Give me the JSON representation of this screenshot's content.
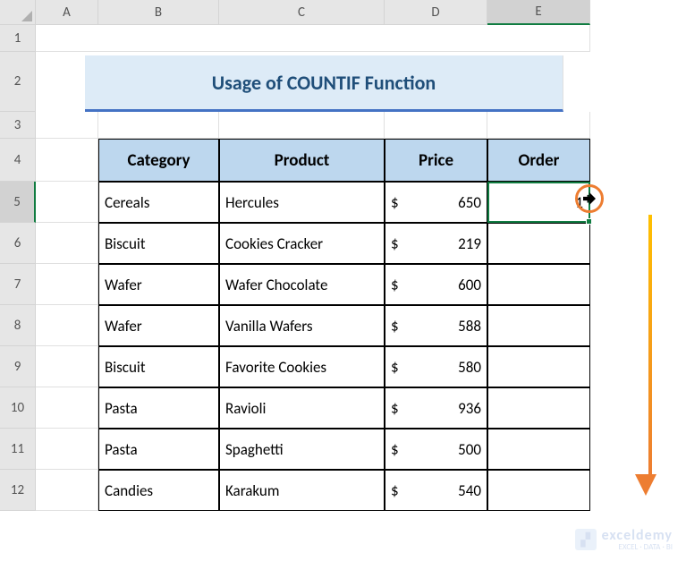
{
  "columns": [
    "A",
    "B",
    "C",
    "D",
    "E"
  ],
  "rows": [
    "1",
    "2",
    "3",
    "4",
    "5",
    "6",
    "7",
    "8",
    "9",
    "10",
    "11",
    "12"
  ],
  "title": "Usage of COUNTIF Function",
  "headers": {
    "category": "Category",
    "product": "Product",
    "price": "Price",
    "order": "Order"
  },
  "currency": "$",
  "data": [
    {
      "category": "Cereals",
      "product": "Hercules",
      "price": "650",
      "order": "1"
    },
    {
      "category": "Biscuit",
      "product": "Cookies Cracker",
      "price": "219",
      "order": ""
    },
    {
      "category": "Wafer",
      "product": "Wafer Chocolate",
      "price": "600",
      "order": ""
    },
    {
      "category": "Wafer",
      "product": "Vanilla Wafers",
      "price": "588",
      "order": ""
    },
    {
      "category": "Biscuit",
      "product": "Favorite Cookies",
      "price": "580",
      "order": ""
    },
    {
      "category": "Pasta",
      "product": "Ravioli",
      "price": "936",
      "order": ""
    },
    {
      "category": "Pasta",
      "product": "Spaghetti",
      "price": "500",
      "order": ""
    },
    {
      "category": "Candies",
      "product": "Karakum",
      "price": "540",
      "order": ""
    }
  ],
  "selected_cell": "E5",
  "watermark": {
    "main": "exceldemy",
    "sub": "EXCEL · DATA · BI"
  }
}
